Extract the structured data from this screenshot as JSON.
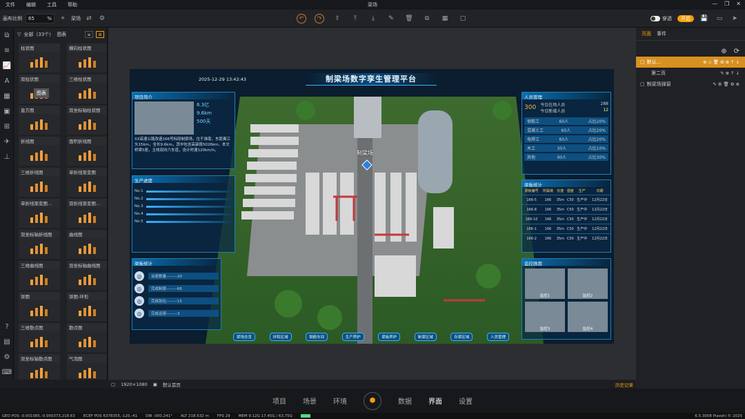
{
  "app": {
    "title": "梁场"
  },
  "menu": [
    "文件",
    "编辑",
    "工具",
    "帮助"
  ],
  "toolbar": {
    "zoom_label": "画布比例",
    "zoom_value": "65",
    "zoom_unit": "%",
    "scene_label": "梁场",
    "toggle_label": "穿透",
    "pill_label": "开启"
  },
  "left": {
    "filter_label": "全部（33个）",
    "view_label": "图表",
    "tooltip": "图表",
    "items": [
      "柱状图",
      "横向柱状图",
      "双柱状图",
      "三维柱状图",
      "直方图",
      "双坐标轴柱状图",
      "折线图",
      "面积折线图",
      "三维折线图",
      "单折线渐变图",
      "单折线渐变图...",
      "双折线渐变图...",
      "双坐标轴折线图",
      "曲线图",
      "三维曲线图",
      "双坐标轴曲线图",
      "饼图",
      "饼图-环形",
      "三维散点图",
      "散点图",
      "双坐标轴散点图",
      "气泡图"
    ]
  },
  "screen": {
    "title": "制梁场数字孪生管理平台",
    "date": "2025-12-29 13:42:43",
    "site_label": "制梁场",
    "intro": {
      "title": "项目简介",
      "stats": [
        "6.3亿",
        "9.6km",
        "500天"
      ],
      "text": "XX高速公路改造166号标段制梁场，位于淮南，东距离江头15km，全长9.6km，其中包含高架段5026km，本文桥梁5座，主线双向六车道，设计时速120km/h。"
    },
    "prod": {
      "title": "生产进度",
      "rows": [
        "No.1",
        "No.2",
        "No.3",
        "No.4",
        "No.5"
      ]
    },
    "beam": {
      "title": "梁板统计",
      "rows": [
        "台座数量--------20",
        "完成制梁--------66",
        "完成张拉--------15",
        "完成运梁--------3"
      ]
    },
    "people": {
      "title": "人员管理",
      "total": "300",
      "total_unit": "人",
      "today_in": "今日在场人员",
      "today_in_val": "288",
      "today_new": "今日新增人员",
      "today_new_val": "12",
      "rows": [
        [
          "钢筋工",
          "60人",
          "占比20%"
        ],
        [
          "混凝土工",
          "60人",
          "占比20%"
        ],
        [
          "电焊工",
          "60人",
          "占比20%"
        ],
        [
          "木工",
          "30人",
          "占比10%"
        ],
        [
          "其他",
          "90人",
          "占比30%"
        ]
      ]
    },
    "beams": {
      "title": "梁板统计",
      "headers": [
        "梁板编号",
        "所属墩",
        "长度",
        "强度",
        "生产",
        "日期"
      ],
      "rows": [
        [
          "166-5",
          "166",
          "35m",
          "C50",
          "生产中",
          "12月22日"
        ],
        [
          "166-8",
          "166",
          "35m",
          "C50",
          "生产中",
          "12月22日"
        ],
        [
          "166-10",
          "166",
          "35m",
          "C50",
          "生产中",
          "12月22日"
        ],
        [
          "166-1",
          "166",
          "35m",
          "C50",
          "生产中",
          "12月22日"
        ],
        [
          "166-2",
          "166",
          "35m",
          "C50",
          "生产中",
          "12月22日"
        ]
      ]
    },
    "monitor": {
      "title": "监控画面",
      "cams": [
        "监控1",
        "监控2",
        "监控3",
        "监控4"
      ]
    },
    "nav": [
      "梁场总览",
      "拌和区域",
      "钢筋车间",
      "生产养护",
      "梁板养护",
      "制梁区域",
      "存梁区域",
      "人员管理"
    ]
  },
  "canvas_status": {
    "size": "1920×1080",
    "home": "默认首页",
    "history": "历史记录"
  },
  "right": {
    "tabs": [
      "页面",
      "事件"
    ],
    "pages": [
      "默认...",
      "第二页",
      "制梁场弹窗"
    ]
  },
  "dock": [
    "项目",
    "场景",
    "环境",
    "数据",
    "界面",
    "设置"
  ],
  "status": {
    "geo": "GEO POS  -0.001085,-0.000373,218.63",
    "ecef": "ECEF POS  6378355,-120,-41",
    "dir": "DIR  -000.241°",
    "alt": "ALT  218.632 m",
    "fps": "FPS  29",
    "mem": "MEM  9.12G  17.45G / 63.75G",
    "ver": "6.5.3008  Piaoshi © 2025"
  }
}
